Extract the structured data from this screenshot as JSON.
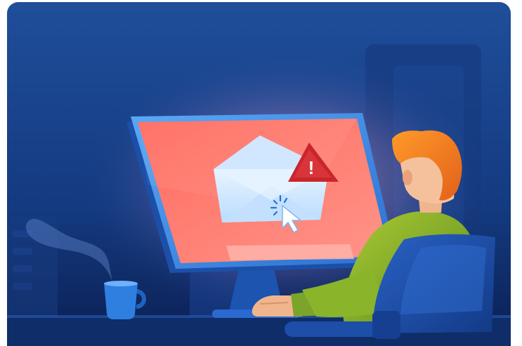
{
  "illustration": {
    "alert_glyph": "!",
    "icons": [
      "envelope-icon",
      "warning-icon",
      "cursor-icon",
      "coffee-mug-icon"
    ],
    "colors": {
      "background_top": "#1f4e9a",
      "background_bottom": "#0b1f52",
      "screen": "#ff6f63",
      "screen_light": "#ff9a8c",
      "monitor_frame": "#3d8fea",
      "warning": "#c8262c",
      "hair": "#f07a1c",
      "shirt": "#8ab52b",
      "chair": "#1a4fa8",
      "mug": "#2f7fe0"
    }
  }
}
